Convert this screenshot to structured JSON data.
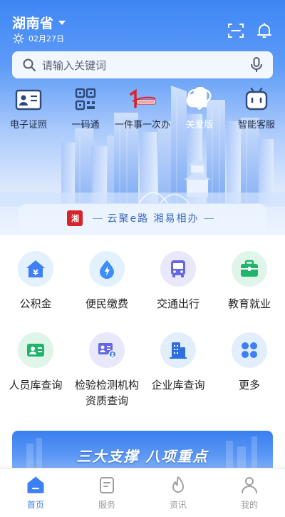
{
  "header": {
    "region": "湖南省",
    "date": "02月27日",
    "icons": [
      "scan-icon",
      "bell-icon",
      "sun-icon"
    ]
  },
  "search": {
    "placeholder": "请输入关键词"
  },
  "quick_links": [
    {
      "label": "电子证照",
      "icon": "id-card-icon"
    },
    {
      "label": "一码通",
      "icon": "qr-code-icon"
    },
    {
      "label": "一件事一次办",
      "icon": "one-thing-logo-icon"
    },
    {
      "label": "关爱版",
      "icon": "heart-icon"
    },
    {
      "label": "智能客服",
      "icon": "robot-icon"
    }
  ],
  "slogan": {
    "logo": "湘",
    "text": "云聚e路  湘易相办"
  },
  "services": [
    {
      "label": "公积金",
      "icon": "housing-fund-icon"
    },
    {
      "label": "便民缴费",
      "icon": "water-drop-icon"
    },
    {
      "label": "交通出行",
      "icon": "bus-icon"
    },
    {
      "label": "教育就业",
      "icon": "briefcase-icon"
    },
    {
      "label": "人员库查询",
      "icon": "id-badge-icon"
    },
    {
      "label": "检验检测机构资质查询",
      "icon": "certificate-icon"
    },
    {
      "label": "企业库查询",
      "icon": "building-icon"
    },
    {
      "label": "更多",
      "icon": "more-grid-icon"
    }
  ],
  "banner": {
    "text": "三大支撑 八项重点"
  },
  "tabs": [
    {
      "label": "首页",
      "icon": "home-icon",
      "active": true
    },
    {
      "label": "服务",
      "icon": "service-doc-icon",
      "active": false
    },
    {
      "label": "资讯",
      "icon": "flame-icon",
      "active": false
    },
    {
      "label": "我的",
      "icon": "user-icon",
      "active": false
    }
  ],
  "colors": {
    "accent": "#3d7ff5",
    "tab_inactive": "#9a9a9a",
    "slogan_logo": "#d8232a"
  }
}
